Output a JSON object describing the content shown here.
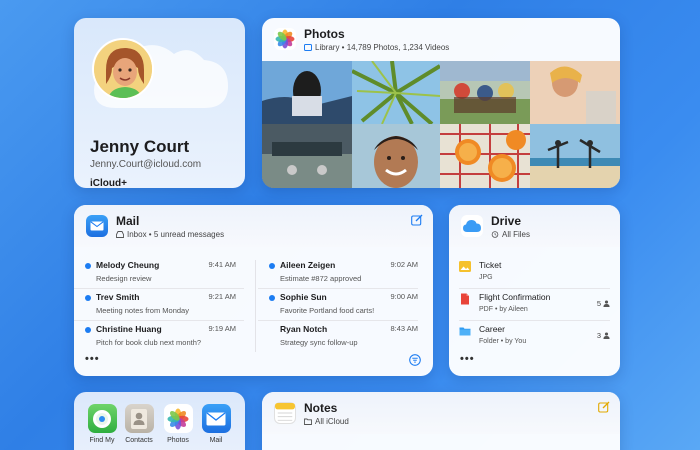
{
  "profile": {
    "name": "Jenny Court",
    "email": "Jenny.Court@icloud.com",
    "plan": "iCloud+"
  },
  "photos": {
    "title": "Photos",
    "subtitle": "Library • 14,789 Photos, 1,234 Videos",
    "icon": "photos-icon"
  },
  "mail": {
    "title": "Mail",
    "subtitle": "Inbox • 5 unread messages",
    "left": [
      {
        "from": "Melody Cheung",
        "subject": "Redesign review",
        "time": "9:41 AM",
        "unread": true
      },
      {
        "from": "Trev Smith",
        "subject": "Meeting notes from Monday",
        "time": "9:21 AM",
        "unread": true
      },
      {
        "from": "Christine Huang",
        "subject": "Pitch for book club next month?",
        "time": "9:19 AM",
        "unread": true
      }
    ],
    "right": [
      {
        "from": "Aileen Zeigen",
        "subject": "Estimate #872 approved",
        "time": "9:02 AM",
        "unread": true
      },
      {
        "from": "Sophie Sun",
        "subject": "Favorite Portland food carts!",
        "time": "9:00 AM",
        "unread": true
      },
      {
        "from": "Ryan Notch",
        "subject": "Strategy sync follow-up",
        "time": "8:43 AM",
        "unread": false
      }
    ],
    "more": "•••"
  },
  "drive": {
    "title": "Drive",
    "subtitle": "All Files",
    "files": [
      {
        "name": "Ticket",
        "meta": "JPG",
        "shared": "",
        "icon": "image-file-icon"
      },
      {
        "name": "Flight Confirmation",
        "meta": "PDF • by Aileen",
        "shared": "5",
        "icon": "pdf-file-icon"
      },
      {
        "name": "Career",
        "meta": "Folder • by You",
        "shared": "3",
        "icon": "folder-icon"
      }
    ],
    "more": "•••"
  },
  "apps": [
    {
      "label": "Find My",
      "icon": "find-my-icon"
    },
    {
      "label": "Contacts",
      "icon": "contacts-icon"
    },
    {
      "label": "Photos",
      "icon": "photos-icon"
    },
    {
      "label": "Mail",
      "icon": "mail-icon"
    }
  ],
  "notes": {
    "title": "Notes",
    "subtitle": "All iCloud"
  },
  "colors": {
    "accent": "#1c7cf2",
    "background": "#3a8cf0"
  }
}
